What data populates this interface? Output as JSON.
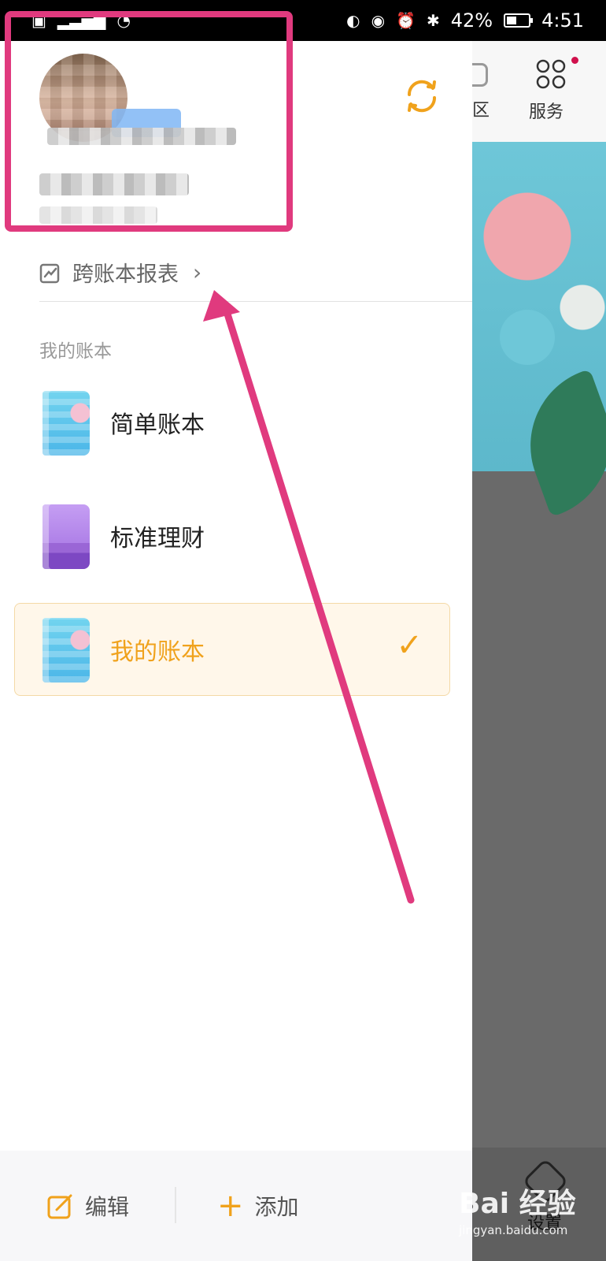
{
  "status_bar": {
    "left_icons": [
      "sim-icon",
      "signal-icon",
      "wifi-icon"
    ],
    "battery_percent": "42%",
    "time": "4:51"
  },
  "background_app": {
    "tabs": [
      {
        "label": "区",
        "icon": "zone-icon"
      },
      {
        "label": "服务",
        "icon": "service-icon",
        "has_notification_dot": true
      }
    ],
    "bottom_tab_label": "设置"
  },
  "drawer": {
    "profile": {
      "avatar": "avatar-blurred",
      "sync_icon": "sync-icon"
    },
    "report_link": {
      "label": "跨账本报表",
      "icon": "report-icon"
    },
    "section_label": "我的账本",
    "books": [
      {
        "name": "简单账本",
        "cover": "blue",
        "selected": false
      },
      {
        "name": "标准理财",
        "cover": "purple",
        "selected": false
      },
      {
        "name": "我的账本",
        "cover": "blue",
        "selected": true
      }
    ],
    "bottom": {
      "edit_label": "编辑",
      "add_label": "添加"
    }
  },
  "colors": {
    "accent": "#f0a21c",
    "annotation": "#e03a7e",
    "selected_bg": "#fff7ea"
  },
  "watermark": {
    "main": "Bai 经验",
    "sub": "jingyan.baidu.com"
  }
}
